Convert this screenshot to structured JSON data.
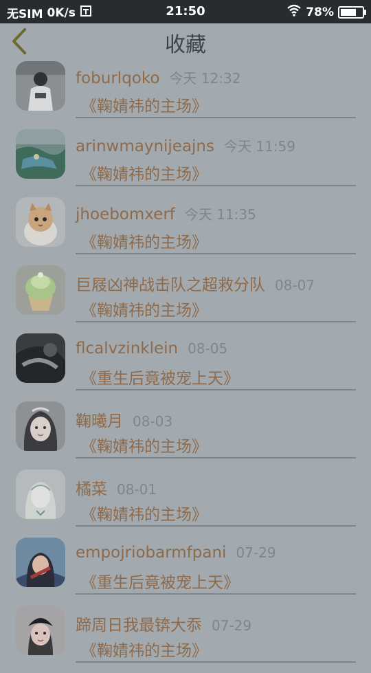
{
  "status": {
    "carrier": "无SIM",
    "speed": "0K/s",
    "time": "21:50",
    "battery": "78%",
    "battery_level": 0.78
  },
  "header": {
    "title": "收藏"
  },
  "items": [
    {
      "name": "foburlqoko",
      "time": "今天 12:32",
      "book": "《鞠婧祎的主场》",
      "avatar": "avatar-1"
    },
    {
      "name": "arinwmaynijeajns",
      "time": "今天 11:59",
      "book": "《鞠婧祎的主场》",
      "avatar": "avatar-2"
    },
    {
      "name": "jhoebomxerf",
      "time": "今天 11:35",
      "book": "《鞠婧祎的主场》",
      "avatar": "avatar-3"
    },
    {
      "name": "巨屐凶神战击队之超救分队",
      "time": "08-07",
      "book": "《鞠婧祎的主场》",
      "avatar": "avatar-4"
    },
    {
      "name": "flcalvzinklein",
      "time": "08-05",
      "book": "《重生后竟被宠上天》",
      "avatar": "avatar-5"
    },
    {
      "name": "鞠曦月",
      "time": "08-03",
      "book": "《鞠婧祎的主场》",
      "avatar": "avatar-6"
    },
    {
      "name": "橘菜",
      "time": "08-01",
      "book": "《鞠婧祎的主场》",
      "avatar": "avatar-7"
    },
    {
      "name": "empojriobarmfpani",
      "time": "07-29",
      "book": "《重生后竟被宠上天》",
      "avatar": "avatar-8"
    },
    {
      "name": "蹄周日我最锛大忝",
      "time": "07-29",
      "book": "《鞠婧祎的主场》",
      "avatar": "avatar-9"
    }
  ]
}
